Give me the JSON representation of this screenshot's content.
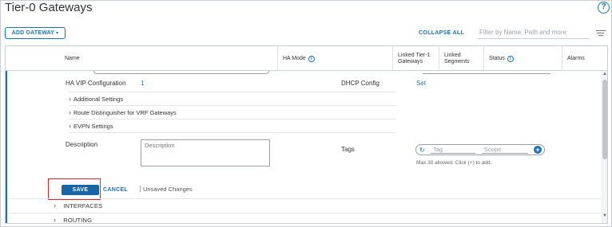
{
  "header": {
    "title": "Tier-0 Gateways",
    "help_icon": "?"
  },
  "toolbar": {
    "add_gateway_label": "ADD GATEWAY",
    "add_gateway_caret": "▾",
    "collapse_all_label": "COLLAPSE ALL",
    "filter_placeholder": "Filter by Name, Path and more",
    "column_icon": "column-toggle-icon"
  },
  "table": {
    "columns": [
      {
        "label": "Name",
        "info": false
      },
      {
        "label": "HA Mode",
        "info": true
      },
      {
        "label": "Linked Tier-1 Gateways",
        "info": false
      },
      {
        "label": "Linked Segments",
        "info": false
      },
      {
        "label": "Status",
        "info": true
      },
      {
        "label": "Alarms",
        "info": false
      }
    ]
  },
  "form": {
    "ha_vip_label": "HA VIP Configuration",
    "ha_vip_value": "1",
    "dhcp_label": "DHCP Config",
    "dhcp_value": "Set",
    "sections": [
      "Additional Settings",
      "Route Distinguisher for VRF Gateways",
      "EVPN Settings"
    ],
    "description_label": "Description",
    "description_placeholder": "Description",
    "tags_label": "Tags",
    "tag_placeholder": "Tag",
    "scope_placeholder": "Scope",
    "tags_hint": "Max 30 allowed. Click (+) to add.",
    "save_label": "SAVE",
    "cancel_label": "CANCEL",
    "unsaved_label": "Unsaved Changes"
  },
  "rows": [
    {
      "label": "INTERFACES"
    },
    {
      "label": "ROUTING"
    }
  ],
  "colors": {
    "accent": "#1a73b7",
    "save_bg": "#1565a8",
    "highlight": "#d9262c"
  }
}
